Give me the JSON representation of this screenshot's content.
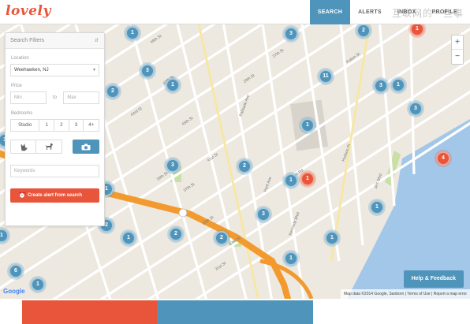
{
  "app": {
    "logo": "lovely"
  },
  "nav": [
    {
      "label": "SEARCH",
      "active": true
    },
    {
      "label": "ALERTS",
      "active": false
    },
    {
      "label": "INBOX",
      "active": false
    },
    {
      "label": "PROFILE",
      "active": false
    }
  ],
  "watermark": "互联网的一些事",
  "filters": {
    "header": "Search Filters",
    "location_label": "Location",
    "location_value": "Weehawken, NJ",
    "price_label": "Price",
    "price_min_placeholder": "Min",
    "price_to": "to",
    "price_max_placeholder": "Max",
    "bedrooms_label": "Bedrooms",
    "bedroom_options": [
      "Studio",
      "1",
      "2",
      "3",
      "4+"
    ],
    "keywords_placeholder": "Keywords",
    "alert_button": "Create alert from search"
  },
  "map": {
    "zoom_in": "+",
    "zoom_out": "−",
    "help_button": "Help & Feedback",
    "attribution": "Map data ©2014 Google, Sanborn  |  Terms of Use  |  Report a map error",
    "google": "Google",
    "street_labels": [
      "48th St",
      "47th St",
      "45th St",
      "43rd St",
      "41st St",
      "39th St",
      "37th St",
      "35th St",
      "33rd St",
      "31st St",
      "29th St",
      "27th St",
      "Palisade Ave",
      "Park Ave",
      "JFK Blvd",
      "Kennedy Blvd",
      "Hudson Pl",
      "Fulton St",
      "Highpoint Rd"
    ],
    "clusters": [
      "1",
      "3",
      "2",
      "3",
      "1",
      "2",
      "1",
      "11",
      "3",
      "1",
      "3",
      "1",
      "1",
      "3",
      "2",
      "1",
      "1",
      "4",
      "1",
      "3",
      "2",
      "1",
      "2",
      "2",
      "1",
      "1",
      "6",
      "1",
      "1",
      "1"
    ]
  },
  "colors": {
    "accent": "#e8553a",
    "primary": "#4f94ba",
    "map_bg": "#ede9e0",
    "highway": "#f39a2f",
    "water": "#a3c7e8",
    "park": "#c8dfa5"
  }
}
